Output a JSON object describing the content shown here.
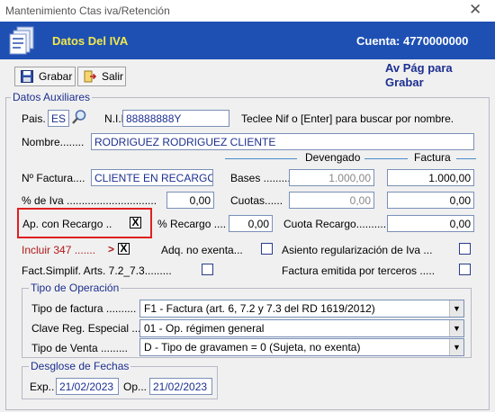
{
  "window": {
    "title": "Mantenimiento Ctas iva/Retención",
    "close": "✕"
  },
  "header": {
    "title": "Datos Del IVA",
    "account": "Cuenta: 4770000000"
  },
  "toolbar": {
    "grabar": "Grabar",
    "salir": "Salir",
    "hint": "Av Pág para Grabar"
  },
  "aux": {
    "legend": "Datos Auxiliares",
    "pais_label": "Pais.",
    "pais_value": "ES",
    "nif_label": "N.I.F.",
    "nif_value": "88888888Y",
    "nif_hint": "Teclee Nif o [Enter] para buscar por nombre.",
    "nombre_label": "Nombre........",
    "nombre_value": "RODRIGUEZ RODRIGUEZ CLIENTE",
    "devengado_label": "Devengado",
    "factura_col_label": "Factura",
    "nfactura_label": "Nº Factura....",
    "nfactura_value": "CLIENTE EN RECARGO",
    "bases_label": "Bases ..........",
    "bases_dev": "1.000,00",
    "bases_fac": "1.000,00",
    "iva_label": "% de Iva ..............................",
    "iva_value": "0,00",
    "cuotas_label": "Cuotas......",
    "cuotas_dev": "0,00",
    "cuotas_fac": "0,00",
    "aprec_label": "Ap. con Recargo ..",
    "aprec_check": "X",
    "precargo_label": "% Recargo ....",
    "precargo_value": "0,00",
    "cuotarec_label": "Cuota Recargo..........",
    "cuotarec_value": "0,00",
    "incluir_label": "Incluir 347 .......",
    "incluir_arrow": ">",
    "incluir_check": "X",
    "adq_label": "Adq. no exenta...",
    "asiento_label": "Asiento regularización de Iva ...",
    "factsimp_label": "Fact.Simplif. Arts. 7.2_7.3.........",
    "emitida_label": "Factura emitida por terceros ....."
  },
  "operacion": {
    "legend": "Tipo de Operación",
    "tipo_factura_label": "Tipo de factura ..........",
    "tipo_factura_value": "F1 - Factura (art. 6, 7.2 y 7.3 del RD 1619/2012)",
    "clave_label": "Clave Reg. Especial ....",
    "clave_value": "01 - Op. régimen general",
    "venta_label": "Tipo de Venta .........",
    "venta_value": "D - Tipo de gravamen = 0 (Sujeta, no exenta)"
  },
  "fechas": {
    "legend": "Desglose de Fechas",
    "exp_label": "Exp..",
    "exp_value": "21/02/2023",
    "op_label": "Op...",
    "op_value": "21/02/2023"
  }
}
